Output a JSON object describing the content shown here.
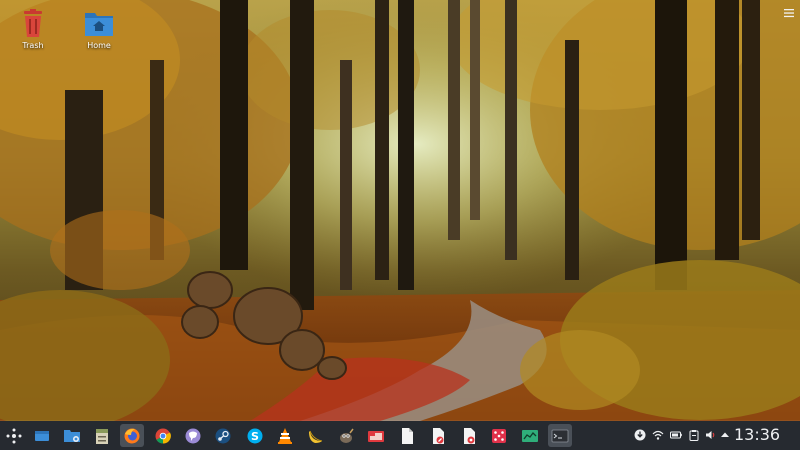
{
  "desktop": {
    "icons": [
      {
        "label": "Trash",
        "icon": "trash-icon"
      },
      {
        "label": "Home",
        "icon": "home-folder-icon"
      }
    ]
  },
  "taskbar": {
    "launchers": [
      {
        "name": "application-menu",
        "icon": "kde-launcher-icon"
      },
      {
        "name": "desktop",
        "icon": "show-desktop-icon"
      },
      {
        "name": "file-manager",
        "icon": "folder-icon"
      },
      {
        "name": "file-cabinet",
        "icon": "cabinet-icon"
      },
      {
        "name": "firefox",
        "icon": "firefox-icon",
        "active": true
      },
      {
        "name": "chrome",
        "icon": "chrome-icon"
      },
      {
        "name": "pidgin",
        "icon": "chat-bubble-icon"
      },
      {
        "name": "steam",
        "icon": "steam-icon"
      },
      {
        "name": "skype",
        "icon": "skype-icon"
      },
      {
        "name": "vlc",
        "icon": "vlc-icon"
      },
      {
        "name": "banana",
        "icon": "banana-icon"
      },
      {
        "name": "gimp",
        "icon": "gimp-icon"
      },
      {
        "name": "screenshot",
        "icon": "screenshot-icon"
      },
      {
        "name": "document",
        "icon": "document-icon"
      },
      {
        "name": "document-editor",
        "icon": "document-edit-icon"
      },
      {
        "name": "document-viewer",
        "icon": "document-view-icon"
      },
      {
        "name": "dice-app",
        "icon": "dice-icon"
      },
      {
        "name": "system-monitor",
        "icon": "monitor-chart-icon"
      },
      {
        "name": "terminal",
        "icon": "terminal-icon"
      }
    ],
    "tray": [
      {
        "name": "updates",
        "icon": "download-icon"
      },
      {
        "name": "network",
        "icon": "wifi-icon"
      },
      {
        "name": "battery",
        "icon": "battery-icon"
      },
      {
        "name": "clipboard",
        "icon": "clipboard-icon"
      },
      {
        "name": "volume",
        "icon": "speaker-icon"
      },
      {
        "name": "expand-tray",
        "icon": "chevron-up-icon"
      }
    ],
    "clock": "13:36"
  },
  "colors": {
    "taskbar_bg": "#262a30",
    "trash_red": "#d9453b",
    "folder_blue": "#3c8ed8"
  }
}
